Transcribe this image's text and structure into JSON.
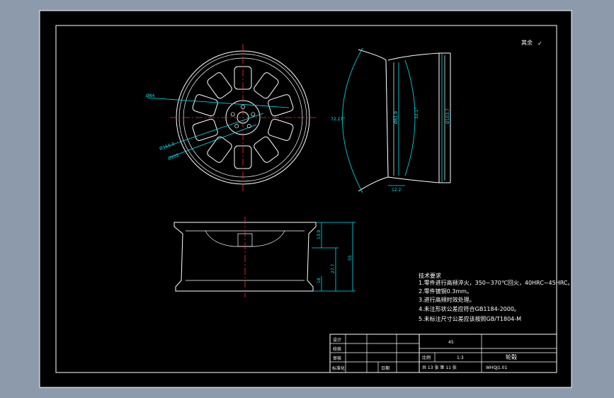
{
  "drawing": {
    "roughness_note": "其余",
    "roughness_symbol": "✓",
    "front_view": {
      "dims": [
        "Ø84",
        "Ø111.3",
        "Ø102"
      ]
    },
    "side_view": {
      "dims": [
        "72.27°",
        "Ø61.9",
        "32.1°",
        "Ø103.7",
        "12.2"
      ]
    },
    "section_view": {
      "dims": [
        "13.9",
        "55",
        "27.7",
        "18"
      ]
    },
    "tech_requirements": {
      "heading": "技术要求",
      "items": [
        "1.零件进行高频淬火，350~370℃回火，40HRC~45HRC。",
        "2.零件镀铜0.3mm。",
        "3.进行高频时效处理。",
        "4.未注形状公差应符合GB1184-2000。",
        "5.未标注尺寸公差应该按照GB/T1804-M"
      ]
    },
    "title_block": {
      "material": "45",
      "labels": {
        "designer": "设计",
        "checker": "校核",
        "approver": "审核",
        "standardization": "标准化",
        "date": "日期"
      },
      "scale_label": "比例",
      "scale_value": "1:3",
      "part_name": "轮毂",
      "sheet_info": "共 13 张  第 11 张",
      "drawing_code": "WHQJ1.01"
    }
  }
}
